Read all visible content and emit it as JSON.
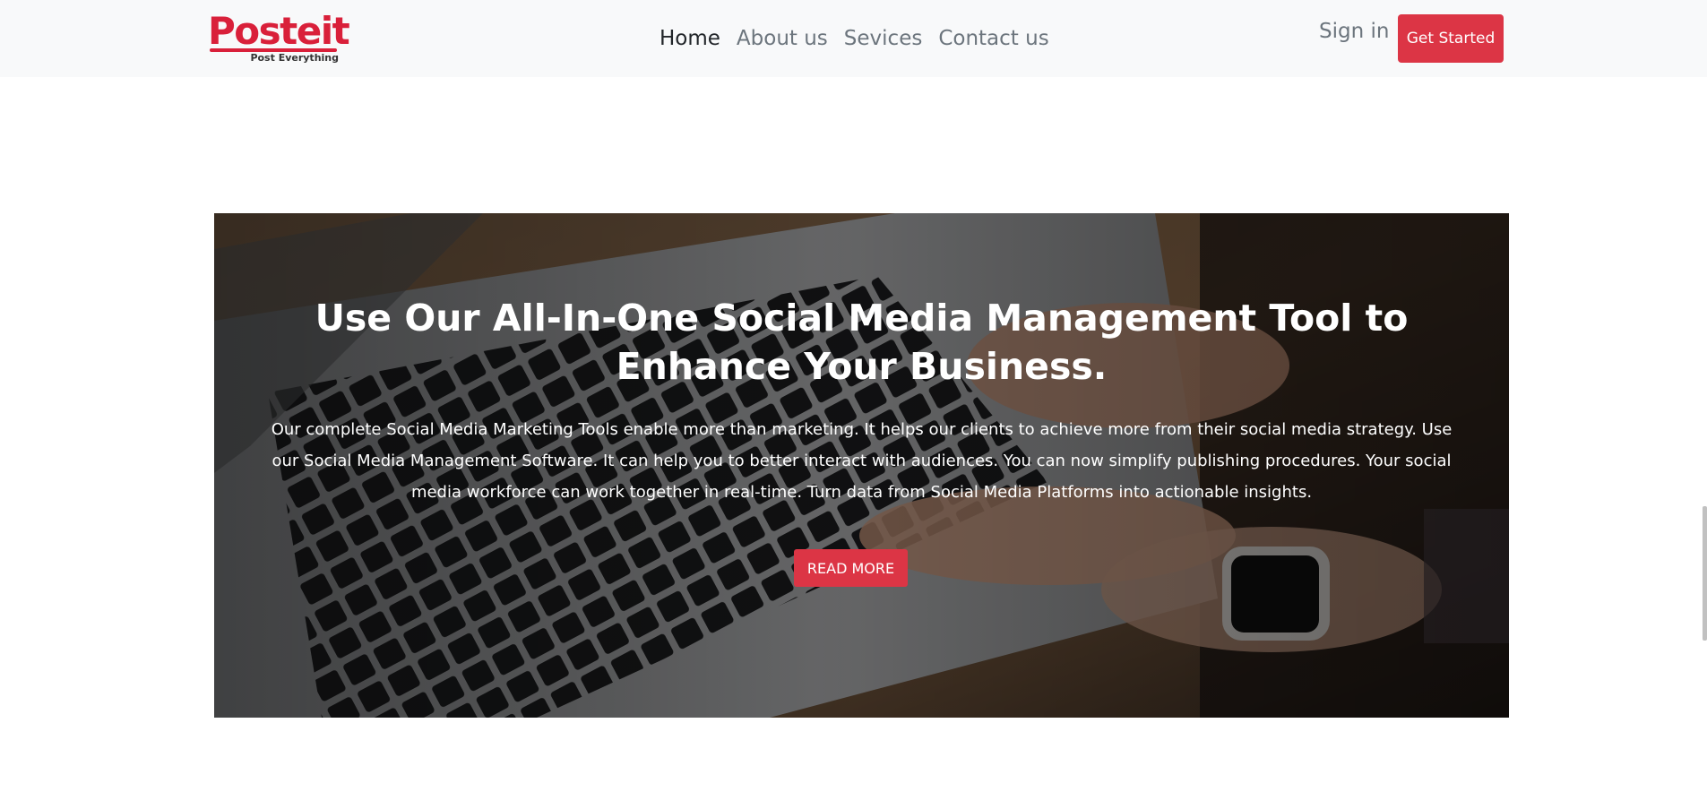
{
  "brand": {
    "name": "Posteit",
    "tagline": "Post Everything",
    "color": "#d9203a"
  },
  "nav": {
    "links": [
      {
        "label": "Home",
        "active": true
      },
      {
        "label": "About us",
        "active": false
      },
      {
        "label": "Sevices",
        "active": false
      },
      {
        "label": "Contact us",
        "active": false
      }
    ],
    "signin_label": "Sign in",
    "cta_label": "Get Started",
    "cta_color": "#dc3545"
  },
  "hero": {
    "title": "Use Our All-In-One Social Media Management Tool to Enhance Your Business.",
    "body": "Our complete Social Media Marketing Tools enable more than marketing. It helps our clients to achieve more from their social media strategy. Use our Social Media Management Software. It can help you to better interact with audiences. You can now simplify publishing procedures. Your social media workforce can work together in real-time. Turn data from Social Media Platforms into actionable insights.",
    "button_label": "READ MORE",
    "background_image": "laptop-keyboard-hands-smartwatch-photo"
  }
}
